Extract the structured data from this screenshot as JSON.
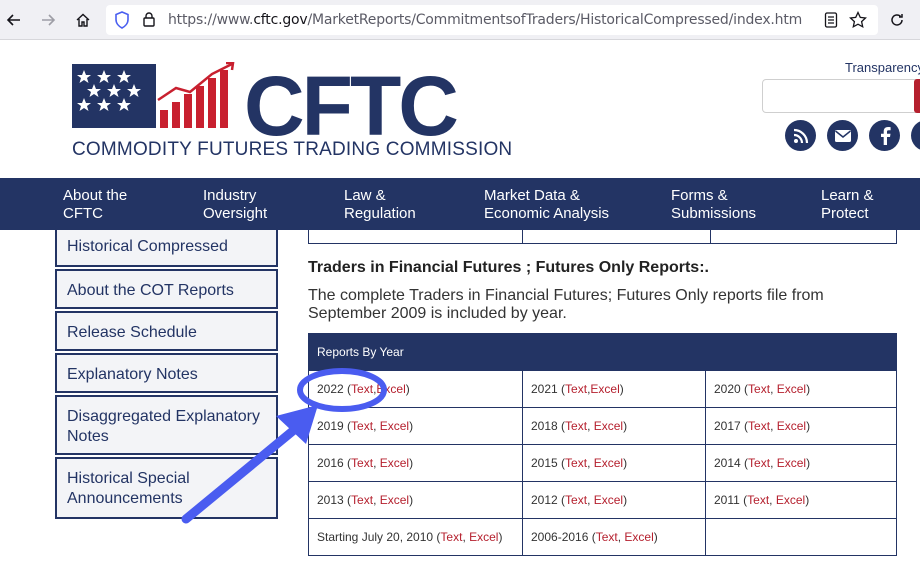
{
  "browser": {
    "url_prefix": "https://www.",
    "url_host": "cftc.gov",
    "url_path": "/MarketReports/CommitmentsofTraders/HistoricalCompressed/index.htm"
  },
  "header": {
    "logo_text": "CFTC",
    "logo_subtitle": "COMMODITY FUTURES TRADING COMMISSION",
    "transparency_link": "Transparency",
    "search_placeholder": "",
    "social_icons": [
      "rss-icon",
      "email-icon",
      "facebook-icon",
      "social-icon"
    ]
  },
  "nav": {
    "items": [
      {
        "label": "About the\nCFTC"
      },
      {
        "label": "Industry\nOversight"
      },
      {
        "label": "Law &\nRegulation"
      },
      {
        "label": "Market Data &\nEconomic Analysis"
      },
      {
        "label": "Forms &\nSubmissions"
      },
      {
        "label": "Learn &\nProtect"
      }
    ]
  },
  "sidebar": {
    "items": [
      {
        "label": "Historical Compressed"
      },
      {
        "label": "About the COT Reports"
      },
      {
        "label": "Release Schedule"
      },
      {
        "label": "Explanatory Notes"
      },
      {
        "label": "Disaggregated Explanatory Notes"
      },
      {
        "label": "Historical Special Announcements"
      }
    ]
  },
  "main": {
    "heading": "Traders in Financial Futures ; Futures Only Reports:.",
    "description": "The complete Traders in Financial Futures; Futures Only reports file from September 2009 is included by year.",
    "table_header": "Reports By Year",
    "text_label": "Text",
    "excel_label": "Excel",
    "rows": [
      [
        {
          "year": "2022"
        },
        {
          "year": "2021"
        },
        {
          "year": "2020"
        }
      ],
      [
        {
          "year": "2019"
        },
        {
          "year": "2018"
        },
        {
          "year": "2017"
        }
      ],
      [
        {
          "year": "2016"
        },
        {
          "year": "2015"
        },
        {
          "year": "2014"
        }
      ],
      [
        {
          "year": "2013"
        },
        {
          "year": "2012"
        },
        {
          "year": "2011"
        }
      ],
      [
        {
          "year": "Starting July 20, 2010"
        },
        {
          "year": "2006-2016"
        },
        {
          "year": ""
        }
      ]
    ]
  },
  "colors": {
    "navy": "#233464",
    "link_red": "#b5202e",
    "annotation_blue": "#4a5cf0"
  }
}
